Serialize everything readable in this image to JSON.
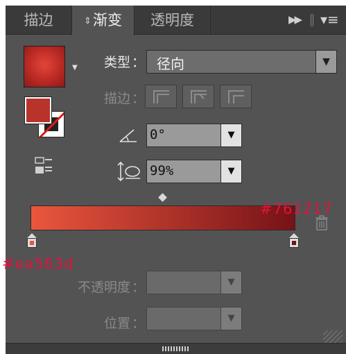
{
  "tabs": [
    {
      "label": "描边"
    },
    {
      "label": "渐变"
    },
    {
      "label": "透明度"
    }
  ],
  "form": {
    "type_label": "类型",
    "type_value": "径向",
    "stroke_label": "描边",
    "angle_value": "0°",
    "aspect_value": "99%",
    "opacity_label": "不透明度",
    "location_label": "位置",
    "colon": "："
  },
  "gradient": {
    "start_color_text": "#ea563d",
    "end_color_text": "#761217",
    "start_color": "#ea563d",
    "end_color": "#761217"
  },
  "icons": {
    "tab_arrows": "up-down-arrows-icon",
    "collapse": "double-chevron-right-icon",
    "menu": "panel-menu-icon",
    "dropdown": "triangle-down-icon",
    "angle": "angle-icon",
    "aspect": "aspect-ratio-icon",
    "arrange": "arrange-icon",
    "trash": "trash-icon",
    "stroke_within": "stroke-within-icon",
    "stroke_along": "stroke-along-icon",
    "stroke_across": "stroke-across-icon"
  }
}
